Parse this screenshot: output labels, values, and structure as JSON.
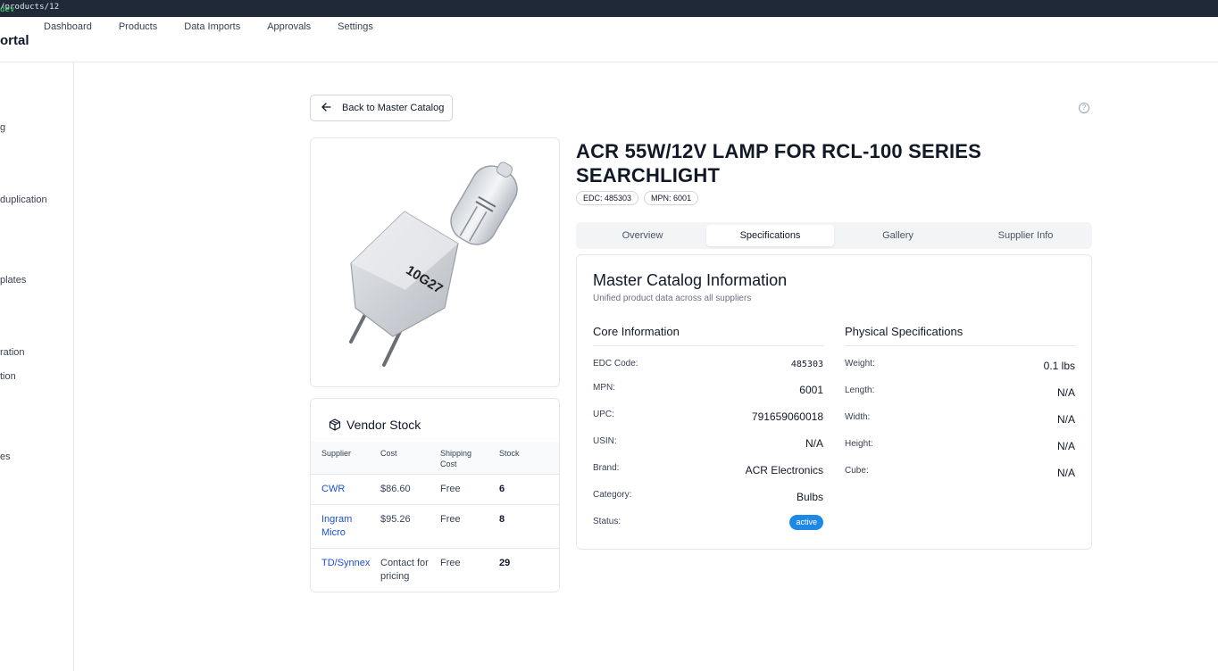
{
  "browser": {
    "url_host": "dev",
    "url_path": "/products/12"
  },
  "topnav": {
    "brand": "ortal",
    "links": [
      "Dashboard",
      "Products",
      "Data Imports",
      "Approvals",
      "Settings"
    ]
  },
  "sidebar": {
    "items": [
      "g",
      "duplication",
      "plates",
      "ration",
      "tion",
      "es"
    ]
  },
  "back_button": "Back to Master Catalog",
  "help_icon_glyph": "?",
  "product": {
    "title_line1": "ACR 55W/12V LAMP FOR RCL-100 SERIES",
    "title_line2": "SEARCHLIGHT",
    "chips": [
      "EDC: 485303",
      "MPN: 6001"
    ],
    "image_label": "10G27"
  },
  "tabs": [
    "Overview",
    "Specifications",
    "Gallery",
    "Supplier Info"
  ],
  "active_tab": "Specifications",
  "vendor_stock": {
    "title": "Vendor Stock",
    "headers": {
      "supplier": "Supplier",
      "cost": "Cost",
      "shipping_l1": "Shipping",
      "shipping_l2": "Cost",
      "stock": "Stock"
    },
    "rows": [
      {
        "supplier": "CWR",
        "supplier_l2": "",
        "cost": "$86.60",
        "cost_l2": "",
        "shipping": "Free",
        "stock": "6"
      },
      {
        "supplier": "Ingram",
        "supplier_l2": "Micro",
        "cost": "$95.26",
        "cost_l2": "",
        "shipping": "Free",
        "stock": "8"
      },
      {
        "supplier": "TD/Synnex",
        "supplier_l2": "",
        "cost": "Contact for",
        "cost_l2": "pricing",
        "shipping": "Free",
        "stock": "29"
      }
    ]
  },
  "master_info": {
    "title": "Master Catalog Information",
    "subtitle": "Unified product data across all suppliers",
    "core": {
      "title": "Core Information",
      "rows": [
        {
          "label": "EDC Code:",
          "value": "485303"
        },
        {
          "label": "MPN:",
          "value": "6001"
        },
        {
          "label": "UPC:",
          "value": "791659060018"
        },
        {
          "label": "USIN:",
          "value": "N/A"
        },
        {
          "label": "Brand:",
          "value": "ACR Electronics"
        },
        {
          "label": "Category:",
          "value": "Bulbs"
        },
        {
          "label": "Status:",
          "value": "active"
        }
      ]
    },
    "physical": {
      "title": "Physical Specifications",
      "rows": [
        {
          "label": "Weight:",
          "value": "0.1 lbs"
        },
        {
          "label": "Length:",
          "value": "N/A"
        },
        {
          "label": "Width:",
          "value": "N/A"
        },
        {
          "label": "Height:",
          "value": "N/A"
        },
        {
          "label": "Cube:",
          "value": "N/A"
        }
      ]
    }
  },
  "colors": {
    "link": "#1d4ed8",
    "status_active": "#1e88e5",
    "url_host": "#4ade80"
  },
  "icons": {
    "back": "arrow-left-icon",
    "help": "help-circle-icon",
    "box": "box-icon"
  }
}
